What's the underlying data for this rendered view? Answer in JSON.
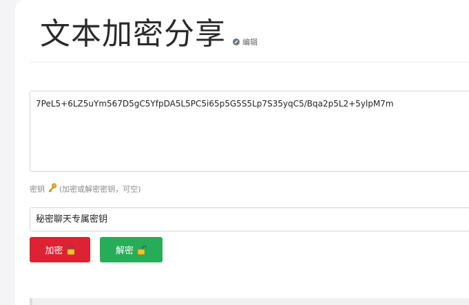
{
  "header": {
    "title": "文本加密分享",
    "edit_label": "编辑"
  },
  "cipher_text": {
    "value": "7PeL5+6LZ5uYm567D5gC5YfpDA5L5PC5i65p5G5S5Lp7S35yqC5/Bqa2p5L2+5ylpM7m"
  },
  "key": {
    "label": "密钥",
    "hint": "(加密或解密密钥，可空)",
    "value": "秘密聊天专属密钥"
  },
  "buttons": {
    "encrypt_label": "加密",
    "decrypt_label": "解密"
  },
  "icons": {
    "edit": "pencil-circle-icon",
    "key": "key-icon",
    "encrypt": "lock-closed-icon",
    "decrypt": "lock-open-icon"
  },
  "colors": {
    "encrypt": "#dc2233",
    "decrypt": "#27ad57",
    "key_icon": "#e0a21b"
  }
}
